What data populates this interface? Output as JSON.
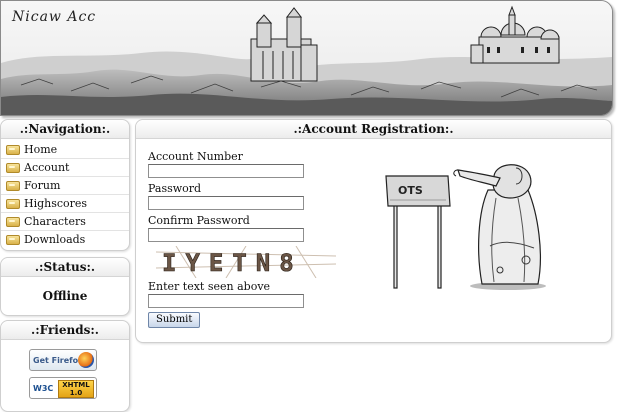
{
  "header": {
    "logo_text": "Nicaw Acc"
  },
  "navigation": {
    "title": ".:Navigation:.",
    "items": [
      {
        "label": "Home"
      },
      {
        "label": "Account"
      },
      {
        "label": "Forum"
      },
      {
        "label": "Highscores"
      },
      {
        "label": "Characters"
      },
      {
        "label": "Downloads"
      }
    ]
  },
  "status": {
    "title": ".:Status:.",
    "value": "Offline"
  },
  "friends": {
    "title": ".:Friends:.",
    "badges": [
      {
        "text": "Get Firefox"
      },
      {
        "text": "W3C",
        "sub": "XHTML 1.0"
      }
    ]
  },
  "registration": {
    "title": ".:Account Registration:.",
    "fields": [
      {
        "label": "Account Number",
        "value": ""
      },
      {
        "label": "Password",
        "value": ""
      },
      {
        "label": "Confirm Password",
        "value": ""
      }
    ],
    "captcha_text": "IYETN8",
    "captcha_label": "Enter text seen above",
    "captcha_value": "",
    "submit_label": "Submit",
    "sign_text": "OTS"
  }
}
